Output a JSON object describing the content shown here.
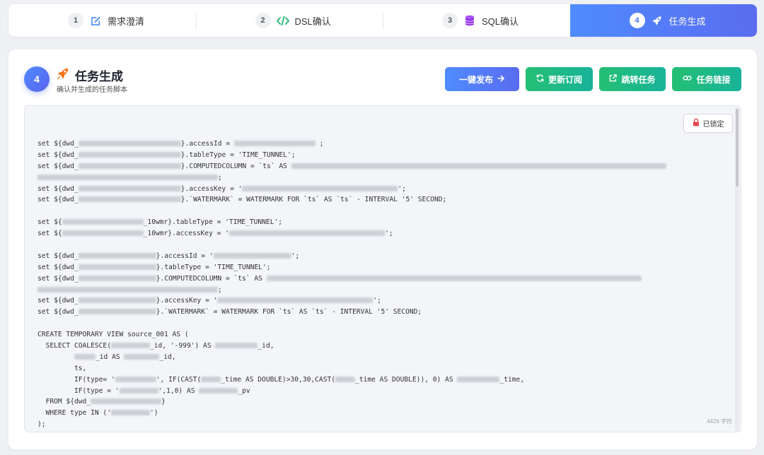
{
  "steps": [
    {
      "num": "1",
      "label": "需求澄清",
      "icon": "edit-icon"
    },
    {
      "num": "2",
      "label": "DSL确认",
      "icon": "code-icon"
    },
    {
      "num": "3",
      "label": "SQL确认",
      "icon": "database-icon"
    },
    {
      "num": "4",
      "label": "任务生成",
      "icon": "rocket-icon"
    }
  ],
  "active_step": 4,
  "header": {
    "badge": "4",
    "title": "任务生成",
    "subtitle": "确认并生成的任务脚本"
  },
  "actions": {
    "publish": "一键发布",
    "update": "更新订阅",
    "jump": "跳转任务",
    "link": "任务链接"
  },
  "editor": {
    "locked_label": "已锁定",
    "char_count": "4426 字符"
  },
  "colors": {
    "accent": "#4f6df0",
    "green": "#22bc78",
    "lock_red": "#e5484d"
  },
  "code_lines": [
    {
      "segs": [
        {
          "t": "set ${dwd_"
        },
        {
          "b": 145
        },
        {
          "t": "}.accessId = "
        },
        {
          "b": 115
        },
        {
          "t": " ;"
        }
      ]
    },
    {
      "segs": [
        {
          "t": "set ${dwd_"
        },
        {
          "b": 145
        },
        {
          "t": "}.tableType = 'TIME_TUNNEL';"
        }
      ]
    },
    {
      "segs": [
        {
          "t": "set ${dwd_"
        },
        {
          "b": 145
        },
        {
          "t": "}.COMPUTEDCOLUMN = `ts` AS "
        },
        {
          "b": 530
        }
      ]
    },
    {
      "segs": [
        {
          "b": 255
        },
        {
          "t": ";"
        }
      ]
    },
    {
      "segs": [
        {
          "t": "set ${dwd_"
        },
        {
          "b": 145
        },
        {
          "t": "}.accessKey = '"
        },
        {
          "b": 220
        },
        {
          "t": "';"
        }
      ]
    },
    {
      "segs": [
        {
          "t": "set ${dwd_"
        },
        {
          "b": 145
        },
        {
          "t": "}.`WATERMARK` = WATERMARK FOR `ts` AS `ts` - INTERVAL '5' SECOND;"
        }
      ]
    },
    {
      "segs": []
    },
    {
      "segs": [
        {
          "t": "set ${"
        },
        {
          "b": 115
        },
        {
          "t": "_10wmr}.tableType = 'TIME_TUNNEL';"
        }
      ]
    },
    {
      "segs": [
        {
          "t": "set ${"
        },
        {
          "b": 115
        },
        {
          "t": "_10wmr}.accessKey = '"
        },
        {
          "b": 220
        },
        {
          "t": "';"
        }
      ]
    },
    {
      "segs": []
    },
    {
      "segs": [
        {
          "t": "set ${dwd_"
        },
        {
          "b": 110
        },
        {
          "t": "}.accessId = '"
        },
        {
          "b": 110
        },
        {
          "t": "';"
        }
      ]
    },
    {
      "segs": [
        {
          "t": "set ${dwd_"
        },
        {
          "b": 110
        },
        {
          "t": "}.tableType = 'TIME_TUNNEL';"
        }
      ]
    },
    {
      "segs": [
        {
          "t": "set ${dwd_"
        },
        {
          "b": 110
        },
        {
          "t": "}.COMPUTEDCOLUMN = `ts` AS "
        },
        {
          "b": 530
        }
      ]
    },
    {
      "segs": [
        {
          "b": 255
        },
        {
          "t": ";"
        }
      ]
    },
    {
      "segs": [
        {
          "t": "set ${dwd_"
        },
        {
          "b": 110
        },
        {
          "t": "}.accessKey = '"
        },
        {
          "b": 220
        },
        {
          "t": "';"
        }
      ]
    },
    {
      "segs": [
        {
          "t": "set ${dwd_"
        },
        {
          "b": 110
        },
        {
          "t": "}.`WATERMARK` = WATERMARK FOR `ts` AS `ts` - INTERVAL '5' SECOND;"
        }
      ]
    },
    {
      "segs": []
    },
    {
      "segs": [
        {
          "t": "CREATE TEMPORARY VIEW source_001 AS ("
        }
      ]
    },
    {
      "segs": [
        {
          "t": "  SELECT COALESCE("
        },
        {
          "b": 55
        },
        {
          "t": "_id, '-999') AS "
        },
        {
          "b": 60
        },
        {
          "t": "_id,"
        }
      ]
    },
    {
      "segs": [
        {
          "t": "         "
        },
        {
          "b": 30
        },
        {
          "t": "_id AS "
        },
        {
          "b": 50
        },
        {
          "t": "_id,"
        }
      ]
    },
    {
      "segs": [
        {
          "t": "         ts,"
        }
      ]
    },
    {
      "segs": [
        {
          "t": "         IF(type= '"
        },
        {
          "b": 58
        },
        {
          "t": "', IF(CAST("
        },
        {
          "b": 28
        },
        {
          "t": "_time AS DOUBLE)>30,30,CAST("
        },
        {
          "b": 28
        },
        {
          "t": "_time AS DOUBLE)), 0) AS "
        },
        {
          "b": 60
        },
        {
          "t": "_time,"
        }
      ]
    },
    {
      "segs": [
        {
          "t": "         IF(type = '"
        },
        {
          "b": 55
        },
        {
          "t": "',1,0) AS "
        },
        {
          "b": 55
        },
        {
          "t": "_pv"
        }
      ]
    },
    {
      "segs": [
        {
          "t": "  FROM ${dwd_"
        },
        {
          "b": 100
        },
        {
          "t": "}"
        }
      ]
    },
    {
      "segs": [
        {
          "t": "  WHERE type IN ('"
        },
        {
          "b": 55
        },
        {
          "t": "')"
        }
      ]
    },
    {
      "segs": [
        {
          "t": ");"
        }
      ]
    }
  ]
}
